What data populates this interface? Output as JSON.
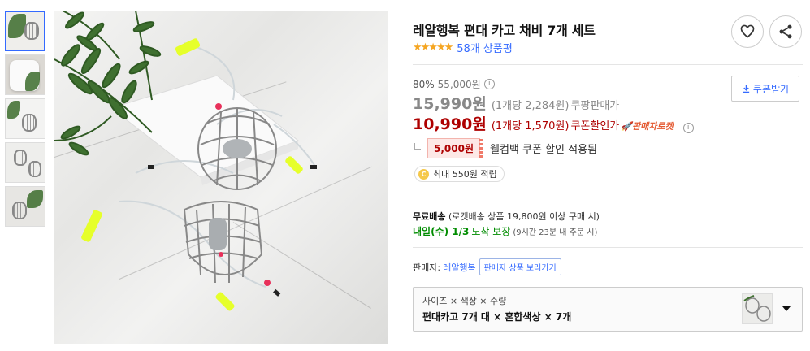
{
  "product": {
    "title": "레알행복 편대 카고 채비 7개 세트",
    "stars": "★★★★★",
    "review_count": "58개 상품평",
    "rating_stars": 5
  },
  "pricing": {
    "discount_rate": "80%",
    "original_price": "55,000원",
    "info_mark": "i",
    "seller_price": "15,990원",
    "seller_unit": "(1개당 2,284원)",
    "seller_label": "쿠팡판매가",
    "coupon_price": "10,990원",
    "coupon_unit": "(1개당 1,570원)",
    "coupon_label": "쿠폰할인가",
    "rocket_label": "판매자로켓",
    "coupon_button": "쿠폰받기"
  },
  "welcome": {
    "chip": "5,000원",
    "text": "웰컴백 쿠폰 할인 적용됨"
  },
  "points": {
    "coin": "C",
    "text": "최대 550원 적립"
  },
  "shipping": {
    "free_label": "무료배송",
    "free_desc": "(로켓배송 상품 19,800원 이상 구매 시)",
    "arrival_day": "내일(수) 1/3",
    "arrival_desc": "도착 보장",
    "cutoff": "(9시간 23분 내 주문 시)"
  },
  "seller": {
    "label": "판매자:",
    "name": "레알행복",
    "link": "판매자 상품 보러가기"
  },
  "option": {
    "label": "사이즈 × 색상 × 수량",
    "value": "편대카고 7개 대 × 혼합색상 × 7개"
  },
  "colors": {
    "accent_blue": "#346aff",
    "price_red": "#ae0000",
    "star": "#f5a623",
    "green": "#008c00",
    "neon_sleeve": "#e6ff2a"
  },
  "icons": {
    "heart": "heart-icon",
    "share": "share-icon",
    "download": "download-icon",
    "caret": "chevron-down-icon"
  }
}
